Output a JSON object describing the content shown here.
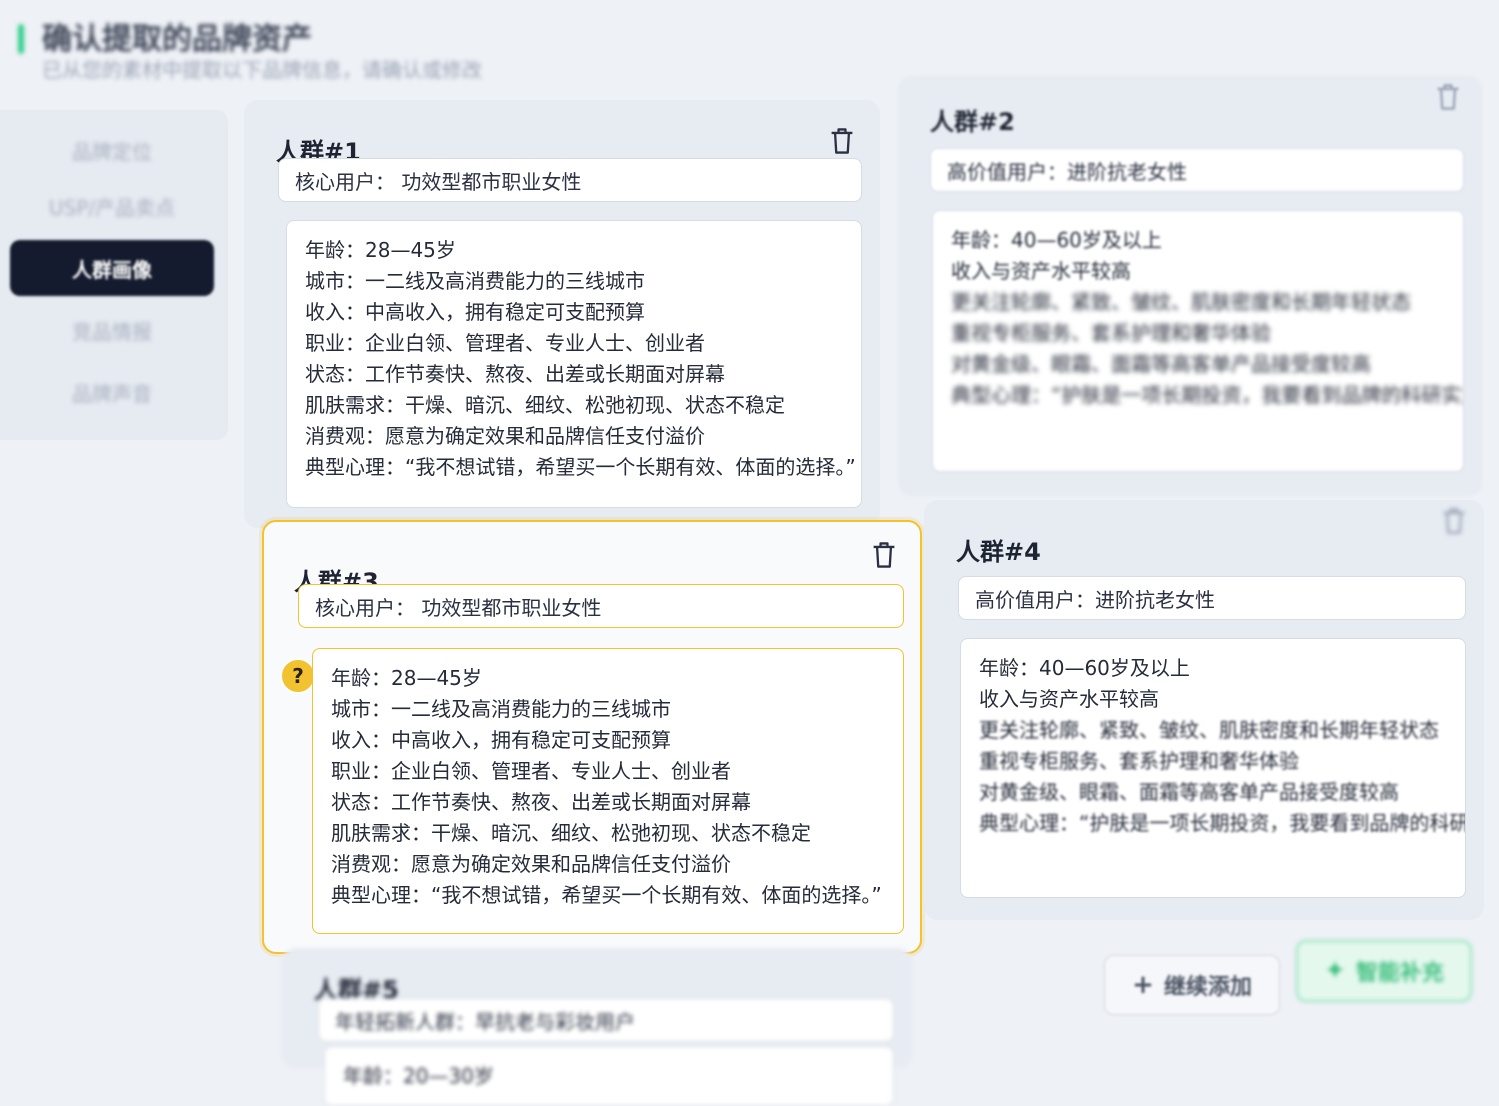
{
  "header": {
    "title": "确认提取的品牌资产",
    "subtitle": "已从您的素材中提取以下品牌信息，请确认或修改",
    "accent_color": "#2fd08a"
  },
  "sidebar": {
    "items": [
      {
        "label": "品牌定位",
        "active": false
      },
      {
        "label": "USP/产品卖点",
        "active": false
      },
      {
        "label": "人群画像",
        "active": true
      },
      {
        "label": "竞品情报",
        "active": false
      },
      {
        "label": "品牌声音",
        "active": false
      }
    ]
  },
  "cards": [
    {
      "title": "人群#1",
      "role": "核心用户： 功效型都市职业女性",
      "details": [
        "年龄：28—45岁",
        "城市：一二线及高消费能力的三线城市",
        "收入：中高收入，拥有稳定可支配预算",
        "职业：企业白领、管理者、专业人士、创业者",
        "状态：工作节奏快、熬夜、出差或长期面对屏幕",
        "肌肤需求：干燥、暗沉、细纹、松弛初现、状态不稳定",
        "消费观：愿意为确定效果和品牌信任支付溢价",
        "典型心理：“我不想试错，希望买一个长期有效、体面的选择。”"
      ]
    },
    {
      "title": "人群#2",
      "role": "高价值用户：进阶抗老女性",
      "details": [
        "年龄：40—60岁及以上",
        "收入与资产水平较高",
        "更关注轮廓、紧致、皱纹、肌肤密度和长期年轻状态",
        "重视专柜服务、套系护理和奢华体验",
        "对黄金级、眼霜、面霜等高客单产品接受度较高",
        "典型心理：“护肤是一项长期投资，我要看到品牌的科研实力。”"
      ]
    },
    {
      "title": "人群#3",
      "role": "核心用户： 功效型都市职业女性",
      "details": [
        "年龄：28—45岁",
        "城市：一二线及高消费能力的三线城市",
        "收入：中高收入，拥有稳定可支配预算",
        "职业：企业白领、管理者、专业人士、创业者",
        "状态：工作节奏快、熬夜、出差或长期面对屏幕",
        "肌肤需求：干燥、暗沉、细纹、松弛初现、状态不稳定",
        "消费观：愿意为确定效果和品牌信任支付溢价",
        "典型心理：“我不想试错，希望买一个长期有效、体面的选择。”"
      ]
    },
    {
      "title": "人群#4",
      "role": "高价值用户：进阶抗老女性",
      "details": [
        "年龄：40—60岁及以上",
        "收入与资产水平较高",
        "更关注轮廓、紧致、皱纹、肌肤密度和长期年轻状态",
        "重视专柜服务、套系护理和奢华体验",
        "对黄金级、眼霜、面霜等高客单产品接受度较高",
        "典型心理：“护肤是一项长期投资，我要看到品牌的科研实力。”"
      ]
    },
    {
      "title": "人群#5",
      "role": "年轻拓新人群：早抗老与彩妆用户",
      "details": [
        "年龄：20—30岁"
      ]
    }
  ],
  "buttons": {
    "continue_label": "继续添加",
    "smart_label": "智能补充"
  },
  "colors": {
    "selected_border": "#f2c230",
    "active_nav": "#151b2e",
    "smart_accent": "#3fc080"
  }
}
